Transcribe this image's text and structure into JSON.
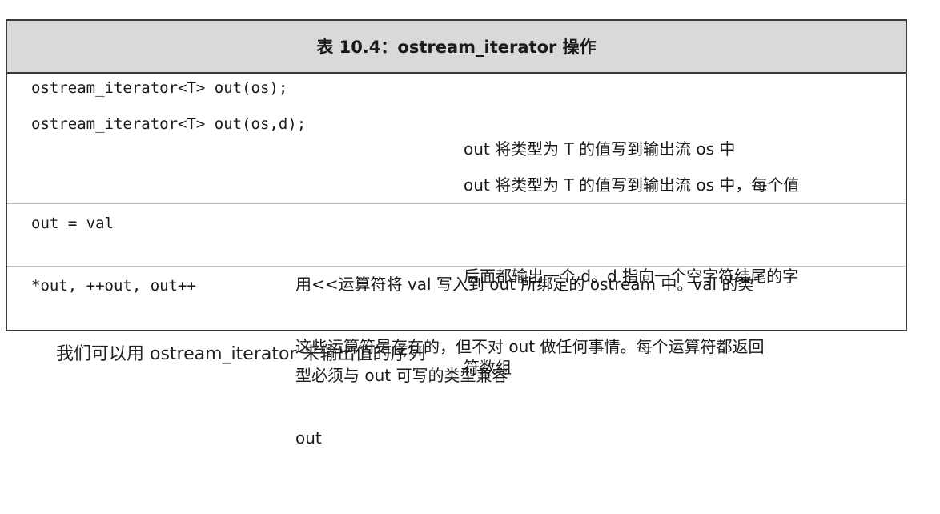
{
  "table": {
    "title": "表 10.4：ostream_iterator 操作",
    "rows": [
      {
        "op": "ostream_iterator<T> out(os);",
        "desc_lines": [
          "out 将类型为 T 的值写到输出流 os 中"
        ]
      },
      {
        "op": "ostream_iterator<T> out(os,d);",
        "desc_lines": [
          "out 将类型为 T 的值写到输出流 os 中，每个值",
          "后面都输出一个 d。d 指向一个空字符结尾的字",
          "符数组"
        ]
      },
      {
        "op": "out = val",
        "desc_lines": [
          "用<<运算符将 val 写入到 out 所绑定的 ostream 中。val 的类",
          "型必须与 out 可写的类型兼容"
        ]
      },
      {
        "op": "*out, ++out, out++",
        "desc_lines": [
          "这些运算符是存在的，但不对 out 做任何事情。每个运算符都返回",
          "out"
        ]
      }
    ]
  },
  "bottom_text": "我们可以用 ostream_iterator 来输出值的序列"
}
